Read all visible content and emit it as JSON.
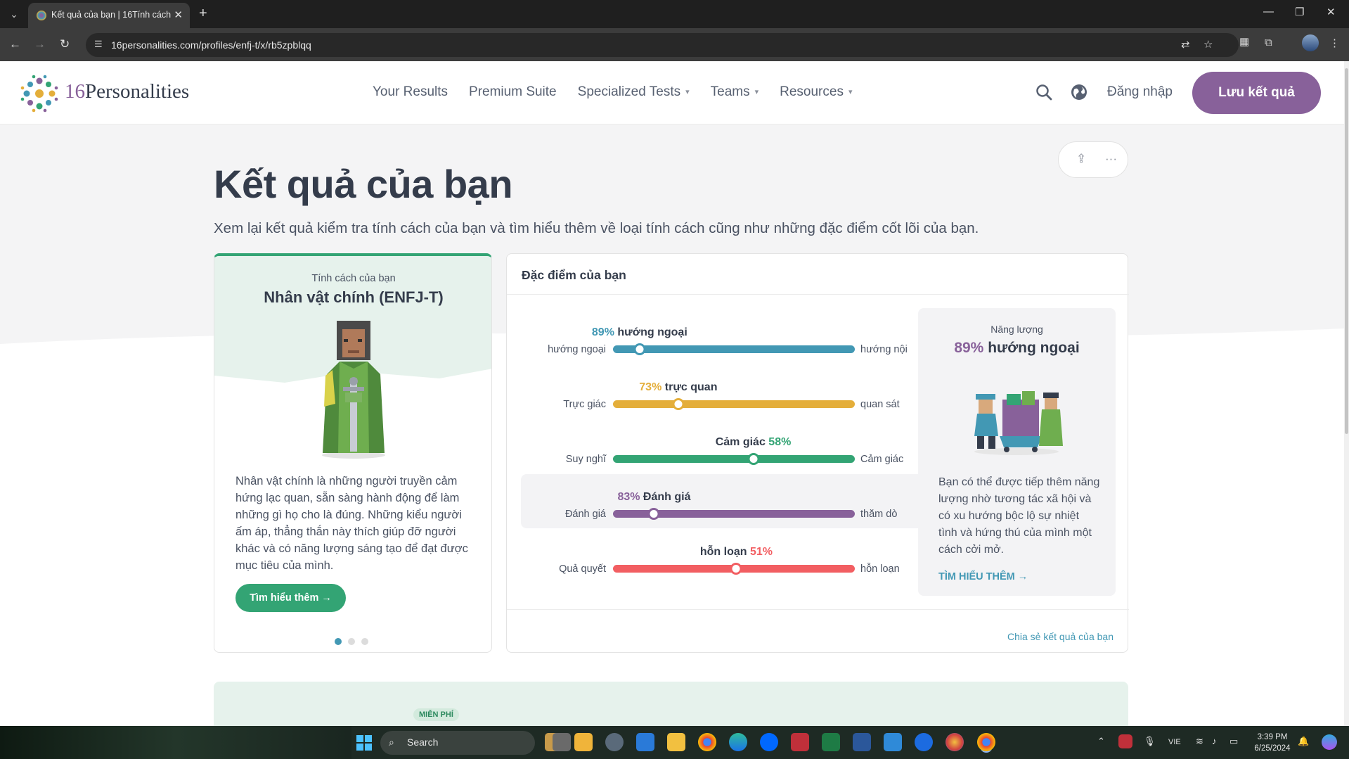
{
  "browser": {
    "tab_title": "Kết quả của bạn | 16Tính cách",
    "url": "16personalities.com/profiles/enfj-t/x/rb5zpblqq"
  },
  "header": {
    "logo_number": "16",
    "logo_word": "Personalities",
    "nav": [
      {
        "label": "Your Results",
        "dropdown": false
      },
      {
        "label": "Premium Suite",
        "dropdown": false
      },
      {
        "label": "Specialized Tests",
        "dropdown": true
      },
      {
        "label": "Teams",
        "dropdown": true
      },
      {
        "label": "Resources",
        "dropdown": true
      }
    ],
    "login": "Đăng nhập",
    "save_button": "Lưu kết quả"
  },
  "page": {
    "title": "Kết quả của bạn",
    "subtitle": "Xem lại kết quả kiểm tra tính cách của bạn và tìm hiểu thêm về loại tính cách cũng như những đặc điểm cốt lõi của bạn."
  },
  "personality_card": {
    "label": "Tính cách của bạn",
    "type": "Nhân vật chính (ENFJ-T)",
    "description": "Nhân vật chính là những người truyền cảm hứng lạc quan, sẵn sàng hành động để làm những gì họ cho là đúng. Những kiểu người ấm áp, thẳng thắn này thích giúp đỡ người khác và có năng lượng sáng tạo để đạt được mục tiêu của mình.",
    "button": "Tìm hiểu thêm",
    "carousel_active": 0
  },
  "traits_card": {
    "title": "Đặc điểm của bạn",
    "share_link": "Chia sẻ kết quả của bạn",
    "traits": [
      {
        "pct": "89%",
        "name": "hướng ngoại",
        "left": "hướng ngoại",
        "right": "hướng nội",
        "position": 0.11,
        "color": "#4298b4"
      },
      {
        "pct": "73%",
        "name": "trực quan",
        "left": "Trực giác",
        "right": "quan sát",
        "position": 0.27,
        "color": "#e4ae3a"
      },
      {
        "pct": "58%",
        "name": "Cảm giác",
        "left": "Suy nghĩ",
        "right": "Cảm giác",
        "position": 0.58,
        "color": "#33a474"
      },
      {
        "pct": "83%",
        "name": "Đánh giá",
        "left": "Đánh giá",
        "right": "thăm dò",
        "position": 0.17,
        "color": "#88619a"
      },
      {
        "pct": "51%",
        "name": "hỗn loạn",
        "left": "Quả quyết",
        "right": "hỗn loạn",
        "position": 0.51,
        "color": "#f25e62"
      }
    ],
    "energy_panel": {
      "label": "Năng lượng",
      "pct": "89%",
      "name": "hướng ngoại",
      "description": "Bạn có thể được tiếp thêm năng lượng nhờ tương tác xã hội và có xu hướng bộc lộ sự nhiệt tình và hứng thú của mình một cách cởi mở.",
      "link": "TÌM HIỂU THÊM"
    }
  },
  "bottom_panel": {
    "badge": "MIỄN PHÍ"
  },
  "taskbar": {
    "search": "Search",
    "language": "VIE",
    "time": "3:39 PM",
    "date": "6/25/2024"
  }
}
